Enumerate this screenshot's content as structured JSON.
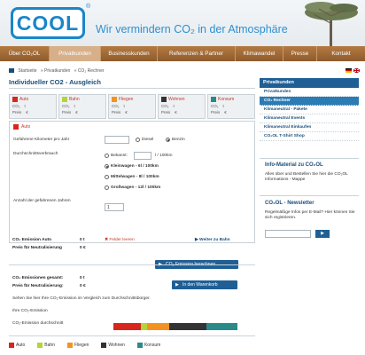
{
  "header": {
    "logo": "COOL",
    "logo_reg": "®",
    "tagline": "Wir vermindern CO₂ in der Atmosphäre"
  },
  "nav": {
    "items": [
      "Über CO₂OL",
      "Privatkunden",
      "Businesskunden",
      "Referenzen & Partner",
      "Klimawandel",
      "Presse",
      "Kontakt"
    ],
    "active_index": 1
  },
  "breadcrumb": [
    "Startseite",
    "» Privatkunden",
    "» CO₂ Rechner"
  ],
  "main": {
    "title": "Individueller CO2 - Ausgleich",
    "categories": [
      {
        "label": "Auto",
        "color": "#d9261c",
        "co2": "CO₂",
        "co2_val": "t",
        "preis": "Preis",
        "preis_val": "€"
      },
      {
        "label": "Bahn",
        "color": "#b5d33b",
        "co2": "CO₂",
        "co2_val": "t",
        "preis": "Preis",
        "preis_val": "€"
      },
      {
        "label": "Fliegen",
        "color": "#f39221",
        "co2": "CO₂",
        "co2_val": "t",
        "preis": "Preis",
        "preis_val": "€"
      },
      {
        "label": "Wohnen",
        "color": "#333333",
        "co2": "CO₂",
        "co2_val": "t",
        "preis": "Preis",
        "preis_val": "€"
      },
      {
        "label": "Konsum",
        "color": "#2a8a8a",
        "co2": "CO₂",
        "co2_val": "t",
        "preis": "Preis",
        "preis_val": "€"
      }
    ],
    "form": {
      "section": "Auto",
      "km_label": "Gefahrene Kilometer pro Jahr",
      "fuel_options": [
        "Diesel",
        "Benzin"
      ],
      "fuel_selected": "Benzin",
      "consumption_label": "Durchschnittsverbrauch",
      "known_label": "Bekannt:",
      "known_unit": "l / 100km",
      "classes": [
        "Kleinwagen - 6l / 100km",
        "Mittelwagen - 8l / 100km",
        "Großwagen - 12l / 100km"
      ],
      "class_selected": "Kleinwagen - 6l / 100km",
      "years_label": "Anzahl der gefahrenen Jahren",
      "years_value": "1",
      "calc_button": "CO₂ Emission berechnen"
    },
    "result": {
      "emission_label": "CO₂ Emission Auto",
      "emission_value": "0 t",
      "price_label": "Preis für Neutralisierung",
      "price_value": "0 €",
      "clear_label": "Felder leeren",
      "next_label": "Weiter zu Bahn",
      "total_label": "CO₂ Emissionen gesamt:",
      "total_value": "0 t",
      "total_price_label": "Preis für Neutralisierung:",
      "total_price_value": "0 €",
      "cart_button": "In den Warenkorb",
      "compare_note": "Sehen Sie hier Ihre CO₂-Emission im Vergleich zum Durchschnittsbürger.",
      "your_emission": "Ihre CO₂-Emission",
      "avg_emission": "CO₂-Emission durchschnitt"
    },
    "avg_bar": [
      {
        "name": "Auto",
        "share": 0.22,
        "color": "#d9261c"
      },
      {
        "name": "Bahn",
        "share": 0.05,
        "color": "#b5d33b"
      },
      {
        "name": "Fliegen",
        "share": 0.18,
        "color": "#f39221"
      },
      {
        "name": "Wohnen",
        "share": 0.3,
        "color": "#333333"
      },
      {
        "name": "Konsum",
        "share": 0.25,
        "color": "#2a8a8a"
      }
    ],
    "legend": [
      "Auto",
      "Bahn",
      "Fliegen",
      "Wohnen",
      "Konsum"
    ]
  },
  "sidebar": {
    "section_title": "Privatkunden",
    "items": [
      "Privatkunden",
      "CO₂ Rechner",
      "Klimaneutral - Pakete",
      "Klimaneutral Events",
      "Klimaneutral Einkaufen",
      "CO₂OL T-Shirt Shop"
    ],
    "active_index": 1,
    "info_title": "Info-Material zu CO₂OL",
    "info_text": "Alles über und Bestellen Sie hier die CO₂OL Informations - Mappe",
    "newsletter_title": "CO₂OL - Newsletter",
    "newsletter_text": "Regelmäßige Infos per E-Mail? Hier können Sie sich registrieren.",
    "newsletter_button": "▶"
  }
}
